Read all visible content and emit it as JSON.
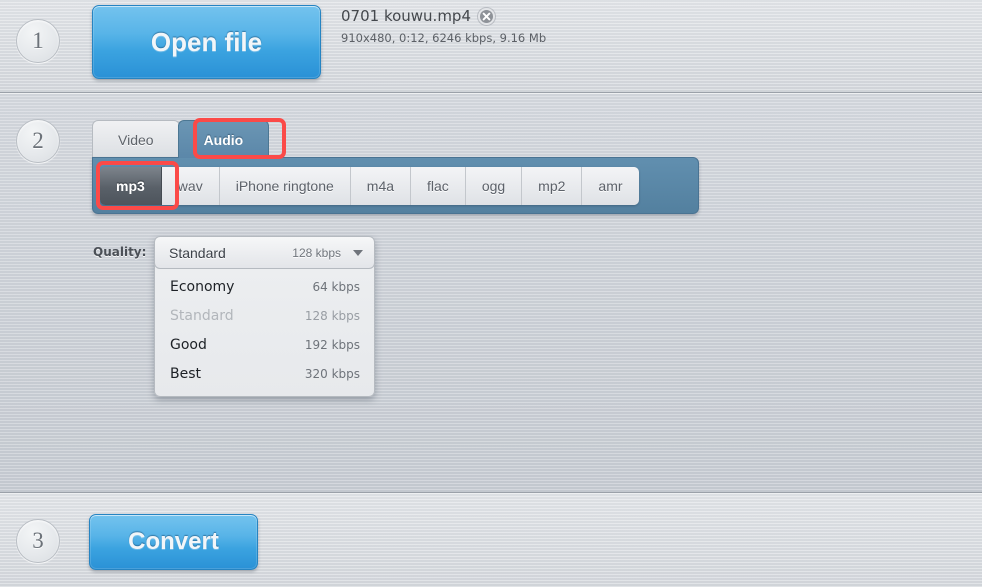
{
  "steps": {
    "one": "1",
    "two": "2",
    "three": "3"
  },
  "step1": {
    "open_button_label": "Open file",
    "file_name": "0701 kouwu.mp4",
    "file_meta": "910x480, 0:12, 6246 kbps, 9.16 Mb",
    "remove_icon": "close-circle-icon"
  },
  "step2": {
    "tabs": [
      {
        "label": "Video",
        "active": false
      },
      {
        "label": "Audio",
        "active": true
      }
    ],
    "formats": [
      {
        "label": "mp3",
        "active": true
      },
      {
        "label": "wav",
        "active": false
      },
      {
        "label": "iPhone ringtone",
        "active": false
      },
      {
        "label": "m4a",
        "active": false
      },
      {
        "label": "flac",
        "active": false
      },
      {
        "label": "ogg",
        "active": false
      },
      {
        "label": "mp2",
        "active": false
      },
      {
        "label": "amr",
        "active": false
      }
    ],
    "quality": {
      "label": "Quality:",
      "selected_name": "Standard",
      "selected_rate": "128 kbps",
      "caret_icon": "chevron-down-icon",
      "options": [
        {
          "name": "Economy",
          "rate": "64 kbps",
          "disabled": false
        },
        {
          "name": "Standard",
          "rate": "128 kbps",
          "disabled": true
        },
        {
          "name": "Good",
          "rate": "192 kbps",
          "disabled": false
        },
        {
          "name": "Best",
          "rate": "320 kbps",
          "disabled": false
        }
      ]
    }
  },
  "step3": {
    "convert_button_label": "Convert"
  },
  "colors": {
    "accent_blue": "#3ba3e0",
    "tab_active_blue": "#5b87a9",
    "highlight_red": "#fb4a48",
    "format_active_grey": "#596068"
  }
}
